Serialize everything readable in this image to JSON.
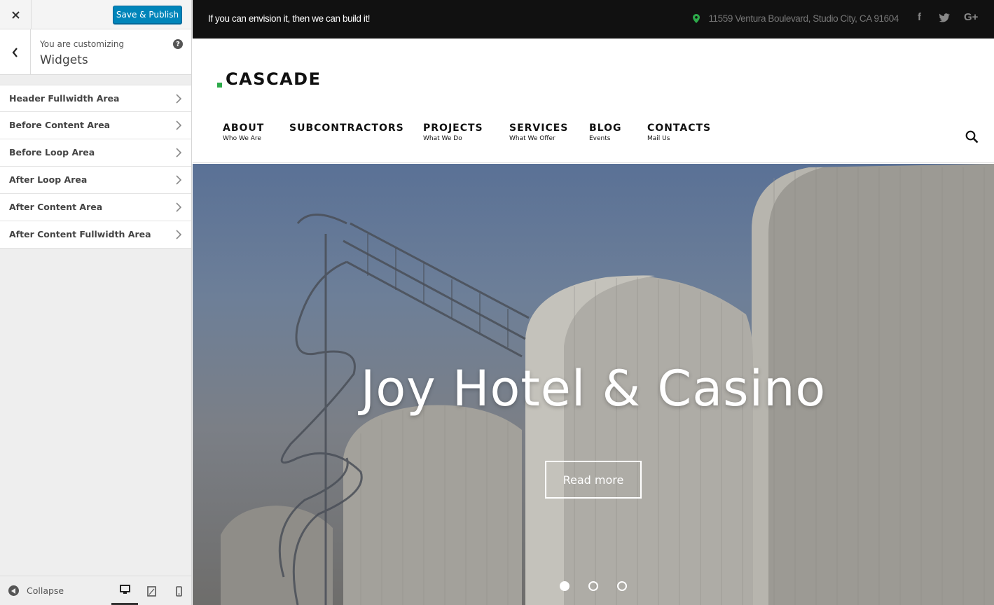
{
  "customizer": {
    "close_icon": "close-icon",
    "save_label": "Save & Publish",
    "customizing_label": "You are customizing",
    "section_title": "Widgets",
    "sections": [
      {
        "label": "Header Fullwidth Area"
      },
      {
        "label": "Before Content Area"
      },
      {
        "label": "Before Loop Area"
      },
      {
        "label": "After Loop Area"
      },
      {
        "label": "After Content Area"
      },
      {
        "label": "After Content Fullwidth Area"
      }
    ],
    "collapse_label": "Collapse",
    "devices": [
      "desktop",
      "tablet",
      "mobile"
    ],
    "active_device": "desktop"
  },
  "site": {
    "tagline": "If you can envision it, then we can build it!",
    "address": "11559 Ventura Boulevard, Studio City, CA 91604",
    "social": {
      "facebook": "f",
      "twitter": "twitter-icon",
      "google": "G+"
    },
    "logo": "CASCADE",
    "accent_color": "#2daa4a",
    "nav": [
      {
        "label": "ABOUT",
        "sub": "Who We Are"
      },
      {
        "label": "SUBCONTRACTORS",
        "sub": ""
      },
      {
        "label": "PROJECTS",
        "sub": "What We Do"
      },
      {
        "label": "SERVICES",
        "sub": "What We Offer"
      },
      {
        "label": "BLOG",
        "sub": "Events"
      },
      {
        "label": "CONTACTS",
        "sub": "Mail Us"
      }
    ],
    "hero": {
      "title": "Joy Hotel & Casino",
      "button": "Read more",
      "slides": 3,
      "active_slide": 1
    }
  }
}
